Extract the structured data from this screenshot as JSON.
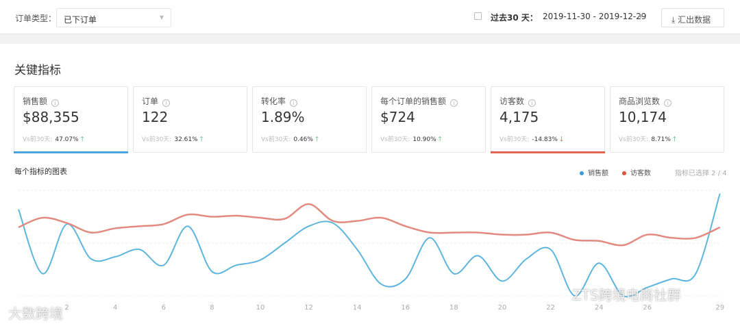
{
  "filter": {
    "label": "订单类型：",
    "value": "已下订单"
  },
  "date": {
    "label": "过去30 天：",
    "value": "2019-11-30 - 2019-12-29"
  },
  "export_label": "汇出数据",
  "section_title": "关键指标",
  "compare_label": "Vs前30天:",
  "cards": [
    {
      "name": "销售额",
      "value": "$88,355",
      "change": "47.07%",
      "dir": "up",
      "selected_color": "#4aa3df"
    },
    {
      "name": "订单",
      "value": "122",
      "change": "32.61%",
      "dir": "up"
    },
    {
      "name": "转化率",
      "value": "1.89%",
      "change": "0.46%",
      "dir": "up"
    },
    {
      "name": "每个订单的销售额",
      "value": "$724",
      "change": "10.90%",
      "dir": "up"
    },
    {
      "name": "访客数",
      "value": "4,175",
      "change": "-14.83%",
      "dir": "down",
      "selected_color": "#e0654f"
    },
    {
      "name": "商品浏览数",
      "value": "10,174",
      "change": "8.71%",
      "dir": "up"
    }
  ],
  "chart_title": "每个指标的图表",
  "selected_text": "指标已选择 2 / 4",
  "watermarks": [
    "大数跨境",
    "ZTS跨境电商社群"
  ],
  "chart_data": {
    "type": "line",
    "x": [
      0,
      1,
      2,
      3,
      4,
      5,
      6,
      7,
      8,
      9,
      10,
      11,
      12,
      13,
      14,
      15,
      16,
      17,
      18,
      19,
      20,
      21,
      22,
      23,
      24,
      25,
      26,
      27,
      28,
      29
    ],
    "xticks": [
      2,
      4,
      6,
      8,
      10,
      12,
      14,
      16,
      18,
      20,
      22,
      24,
      26,
      29
    ],
    "ylim": [
      0,
      100
    ],
    "series": [
      {
        "name": "销售额",
        "color": "#5bb5dc",
        "values": [
          82,
          21,
          68,
          35,
          37,
          44,
          29,
          66,
          23,
          29,
          34,
          50,
          66,
          69,
          44,
          11,
          16,
          55,
          21,
          38,
          14,
          35,
          44,
          0,
          31,
          0,
          8,
          16,
          21,
          97
        ]
      },
      {
        "name": "访客数",
        "color": "#e28a80",
        "values": [
          65,
          74,
          69,
          60,
          64,
          66,
          68,
          77,
          75,
          76,
          74,
          73,
          87,
          71,
          71,
          74,
          66,
          60,
          60,
          60,
          58,
          58,
          60,
          53,
          52,
          48,
          58,
          55,
          55,
          65
        ]
      }
    ]
  }
}
